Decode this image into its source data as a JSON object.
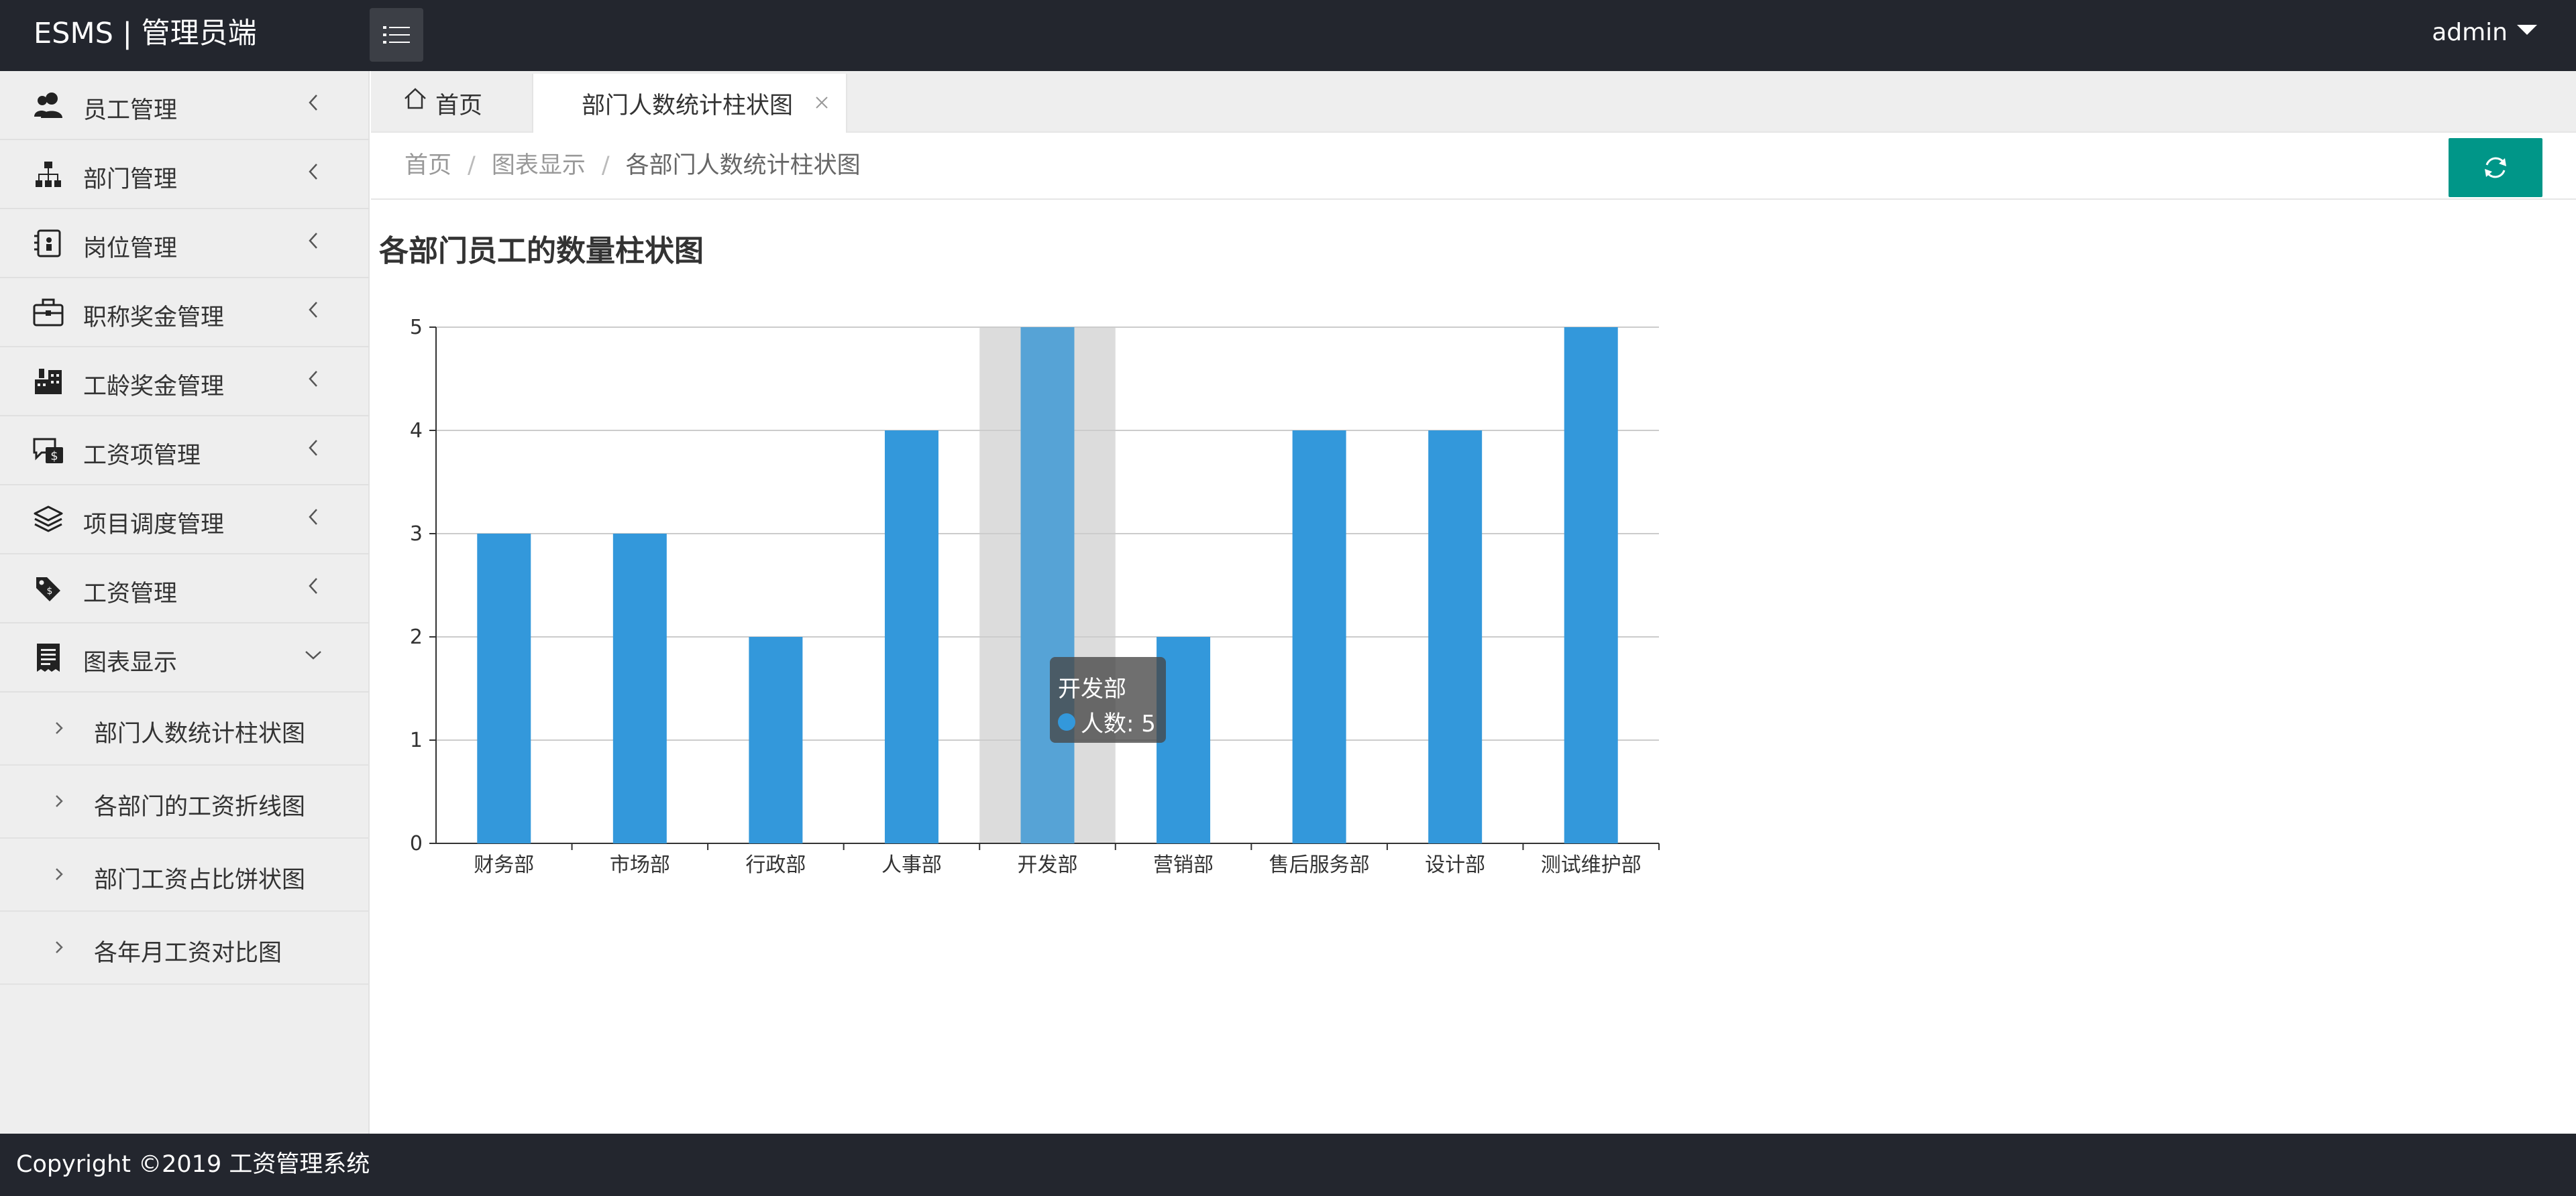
{
  "app": {
    "brand": "ESMS | 管理员端",
    "user": "admin"
  },
  "sidebar": {
    "items": [
      {
        "label": "员工管理",
        "icon": "user-group-icon"
      },
      {
        "label": "部门管理",
        "icon": "org-chart-icon"
      },
      {
        "label": "岗位管理",
        "icon": "badge-icon"
      },
      {
        "label": "职称奖金管理",
        "icon": "briefcase-icon"
      },
      {
        "label": "工龄奖金管理",
        "icon": "building-icon"
      },
      {
        "label": "工资项管理",
        "icon": "salary-chat-icon"
      },
      {
        "label": "项目调度管理",
        "icon": "layers-icon"
      },
      {
        "label": "工资管理",
        "icon": "price-tag-icon"
      },
      {
        "label": "图表显示",
        "icon": "receipt-icon"
      }
    ],
    "subitems": [
      {
        "label": "部门人数统计柱状图"
      },
      {
        "label": "各部门的工资折线图"
      },
      {
        "label": "部门工资占比饼状图"
      },
      {
        "label": "各年月工资对比图"
      }
    ]
  },
  "tabs": {
    "home": "首页",
    "active": "部门人数统计柱状图"
  },
  "breadcrumb": {
    "items": [
      "首页",
      "图表显示",
      "各部门人数统计柱状图"
    ]
  },
  "chart": {
    "title": "各部门员工的数量柱状图"
  },
  "chart_data": {
    "type": "bar",
    "title": "各部门员工的数量柱状图",
    "categories": [
      "财务部",
      "市场部",
      "行政部",
      "人事部",
      "开发部",
      "营销部",
      "售后服务部",
      "设计部",
      "测试维护部"
    ],
    "series": [
      {
        "name": "人数",
        "values": [
          3,
          3,
          2,
          4,
          5,
          2,
          4,
          4,
          5
        ]
      }
    ],
    "ylim": [
      0,
      5
    ],
    "yticks": [
      0,
      1,
      2,
      3,
      4,
      5
    ],
    "grid": true,
    "bar_color": "#3398db",
    "highlight_color": "#56a3d6"
  },
  "tooltip": {
    "title": "开发部",
    "series_name": "人数",
    "value_text": "人数: 5",
    "dot_color": "#3398db"
  },
  "footer": {
    "text": "Copyright ©2019 工资管理系统"
  },
  "colors": {
    "header_bg": "#23262e",
    "accent": "#009688",
    "bar": "#3398db"
  }
}
